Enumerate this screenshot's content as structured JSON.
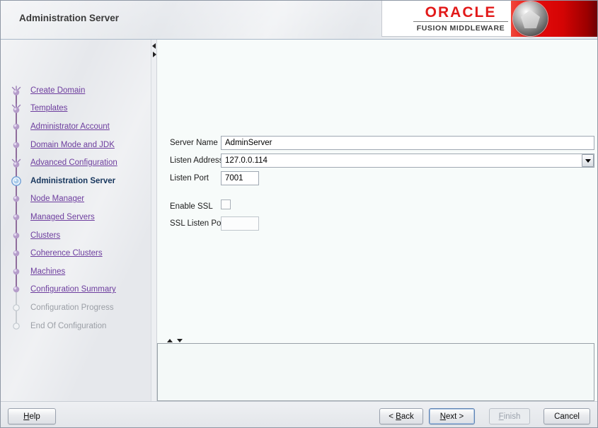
{
  "header": {
    "title": "Administration Server",
    "brand_primary": "ORACLE",
    "brand_secondary": "FUSION MIDDLEWARE"
  },
  "sidebar": {
    "steps": [
      {
        "label": "Create Domain",
        "icon": "burst",
        "state": "done"
      },
      {
        "label": "Templates",
        "icon": "burst",
        "state": "done"
      },
      {
        "label": "Administrator Account",
        "icon": "ball",
        "state": "done"
      },
      {
        "label": "Domain Mode and JDK",
        "icon": "ball",
        "state": "done"
      },
      {
        "label": "Advanced Configuration",
        "icon": "burst",
        "state": "done"
      },
      {
        "label": "Administration Server",
        "icon": "current",
        "state": "current"
      },
      {
        "label": "Node Manager",
        "icon": "ball",
        "state": "link"
      },
      {
        "label": "Managed Servers",
        "icon": "ball",
        "state": "link"
      },
      {
        "label": "Clusters",
        "icon": "ball",
        "state": "link"
      },
      {
        "label": "Coherence Clusters",
        "icon": "ball",
        "state": "link"
      },
      {
        "label": "Machines",
        "icon": "ball",
        "state": "link"
      },
      {
        "label": "Configuration Summary",
        "icon": "ball",
        "state": "link"
      },
      {
        "label": "Configuration Progress",
        "icon": "hollow",
        "state": "disabled"
      },
      {
        "label": "End Of Configuration",
        "icon": "hollow",
        "state": "disabled"
      }
    ]
  },
  "form": {
    "server_name_label": "Server Name",
    "server_name_value": "AdminServer",
    "listen_address_label": "Listen Address",
    "listen_address_value": "127.0.0.114",
    "listen_port_label": "Listen Port",
    "listen_port_value": "7001",
    "enable_ssl_label": "Enable SSL",
    "enable_ssl_checked": false,
    "ssl_listen_port_label": "SSL Listen Port",
    "ssl_listen_port_value": ""
  },
  "footer": {
    "buttons": [
      {
        "id": "help",
        "label": "Help",
        "mnemonic": "H",
        "state": "normal"
      },
      {
        "id": "back",
        "label": "< Back",
        "mnemonic": "B",
        "state": "normal"
      },
      {
        "id": "next",
        "label": "Next >",
        "mnemonic": "N",
        "state": "focused"
      },
      {
        "id": "finish",
        "label": "Finish",
        "mnemonic": "F",
        "state": "disabled"
      },
      {
        "id": "cancel",
        "label": "Cancel",
        "mnemonic": "",
        "state": "normal"
      }
    ]
  },
  "colors": {
    "oracle_red": "#e21a1a",
    "link_purple": "#6d3d9e",
    "current_step_navy": "#17365d"
  }
}
